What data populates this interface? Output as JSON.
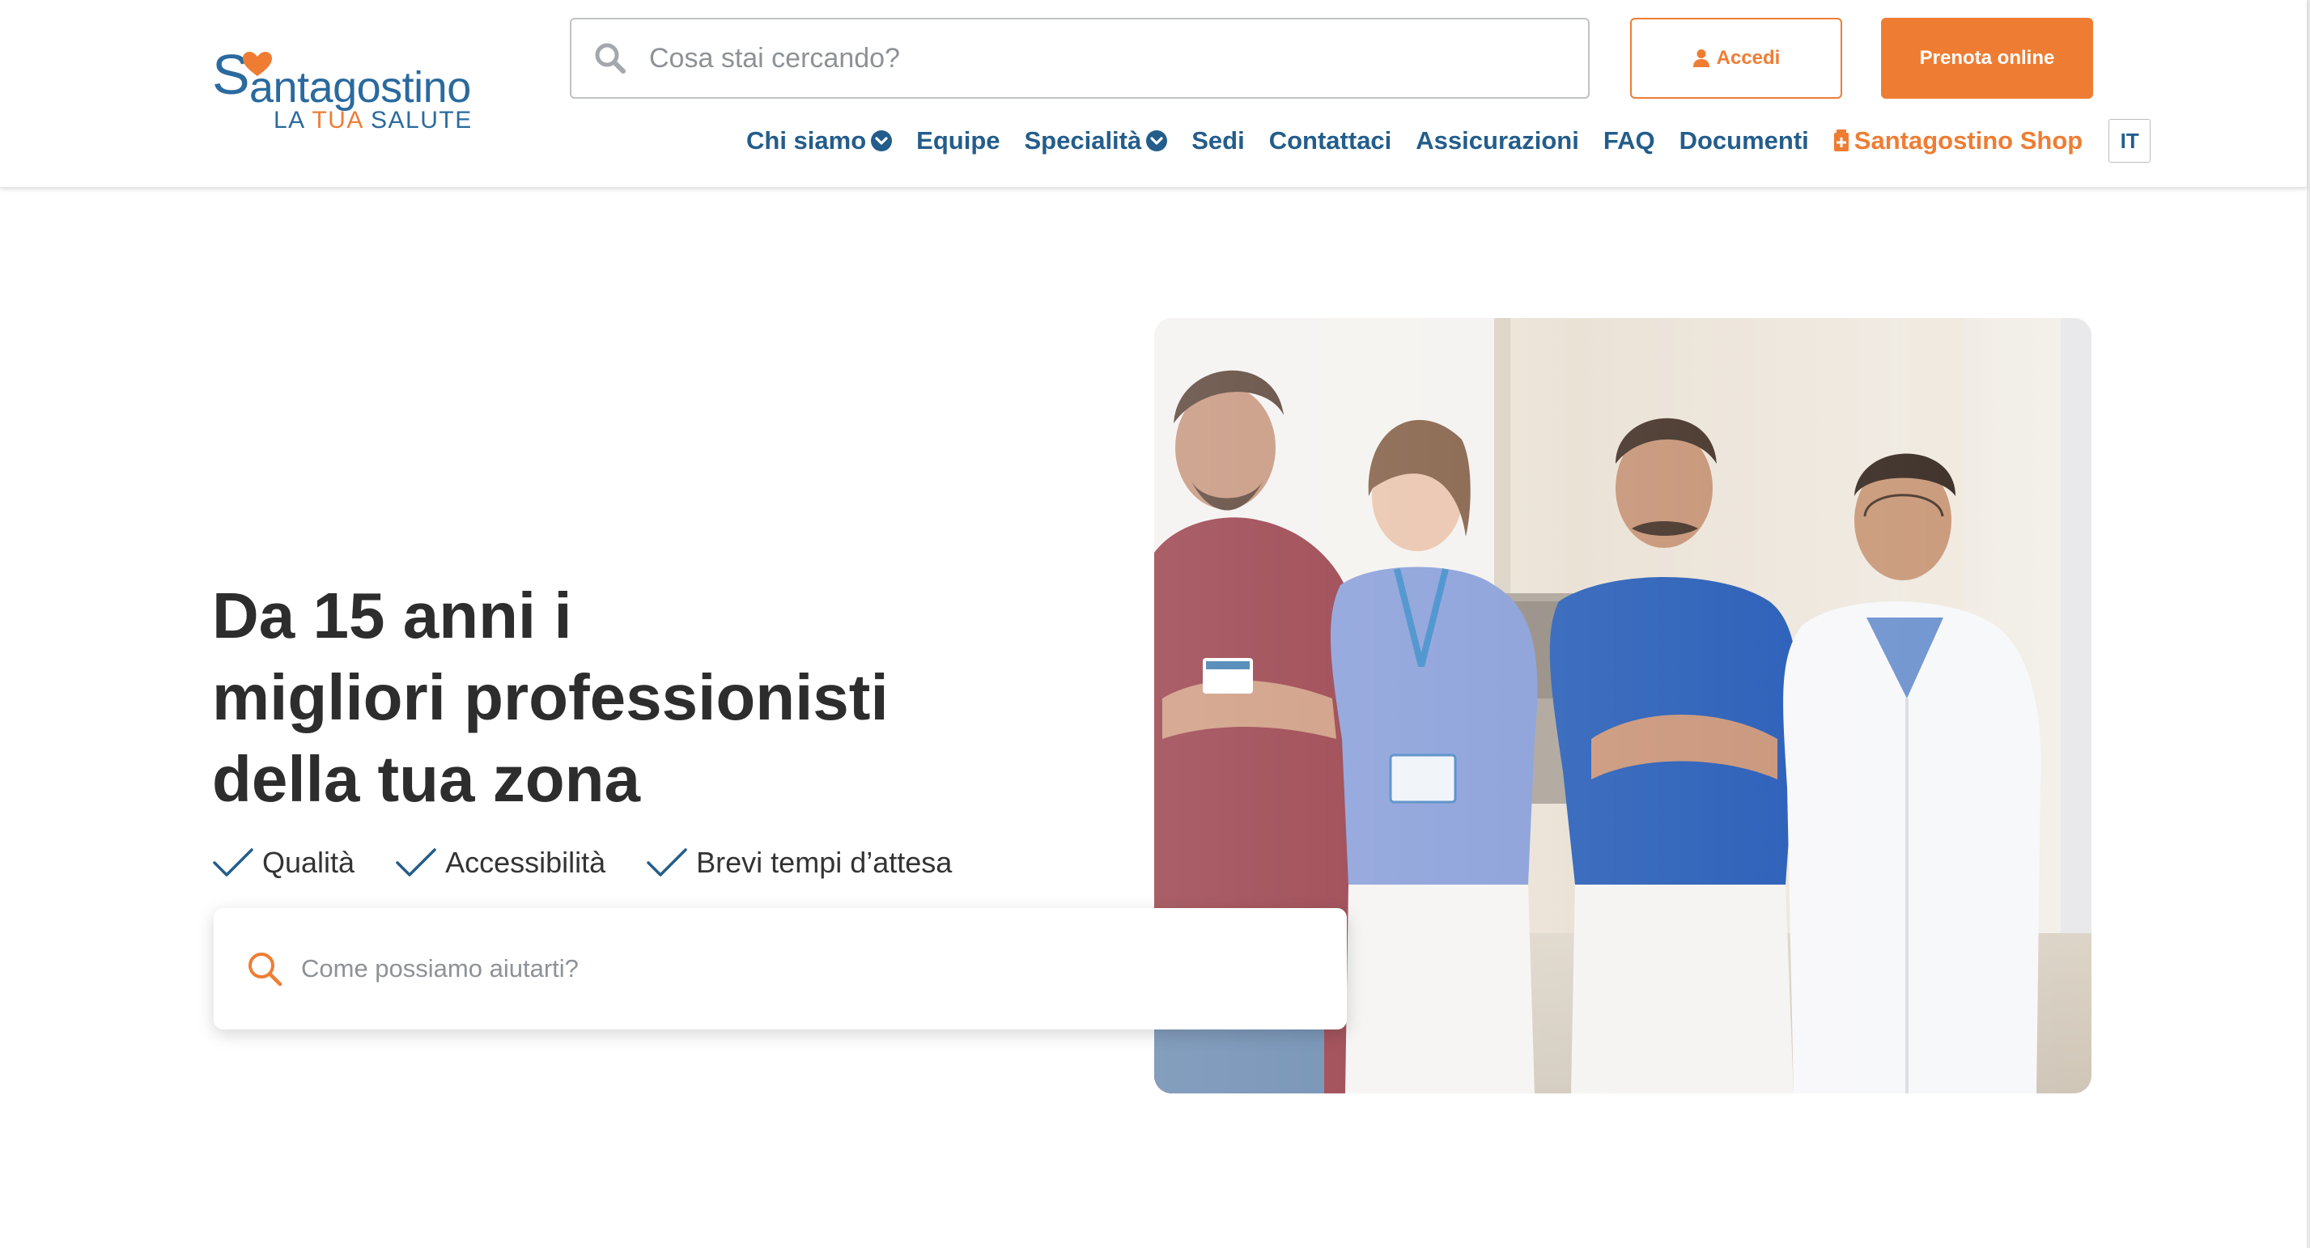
{
  "brand": {
    "logo_initial": "S",
    "logo_word": "antagostino",
    "tagline_pre": "LA ",
    "tagline_accent": "TUA",
    "tagline_post": " SALUTE"
  },
  "header": {
    "search_placeholder": "Cosa stai cercando?",
    "login_label": "Accedi",
    "book_label": "Prenota online",
    "language": "IT"
  },
  "nav": {
    "items": [
      {
        "label": "Chi siamo",
        "dropdown": true
      },
      {
        "label": "Equipe",
        "dropdown": false
      },
      {
        "label": "Specialità",
        "dropdown": true
      },
      {
        "label": "Sedi",
        "dropdown": false
      },
      {
        "label": "Contattaci",
        "dropdown": false
      },
      {
        "label": "Assicurazioni",
        "dropdown": false
      },
      {
        "label": "FAQ",
        "dropdown": false
      },
      {
        "label": "Documenti",
        "dropdown": false
      }
    ],
    "shop_label": "Santagostino Shop"
  },
  "hero": {
    "title_line1": "Da 15 anni i",
    "title_line2": "migliori professionisti",
    "title_line3": "della tua zona",
    "features": [
      "Qualità",
      "Accessibilità",
      "Brevi tempi d’attesa"
    ],
    "search_placeholder": "Come possiamo aiutarti?"
  },
  "colors": {
    "brand_blue": "#235d8b",
    "brand_orange": "#ee7d33",
    "text_dark": "#2d2d2d"
  },
  "icons": {
    "top_search": "search-icon",
    "hero_search": "search-icon",
    "login": "user-icon",
    "shop": "shop-bag-icon",
    "dropdown": "chevron-down-circle-icon",
    "feature": "checkmark-icon"
  }
}
